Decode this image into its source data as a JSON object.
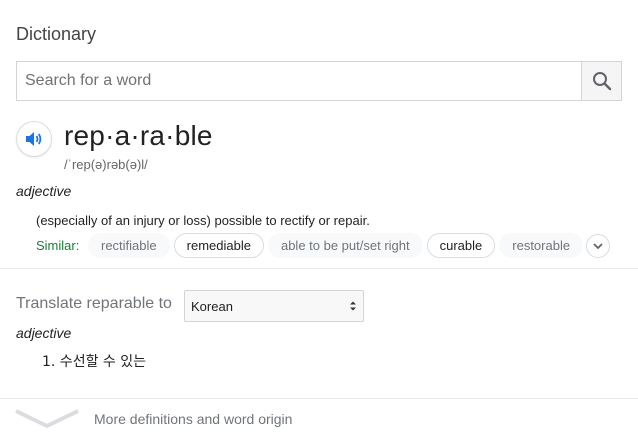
{
  "header": {
    "title": "Dictionary"
  },
  "search": {
    "placeholder": "Search for a word",
    "value": ""
  },
  "entry": {
    "word": "rep·a·ra·ble",
    "phonetic": "/ˈrep(ə)rəb(ə)l/",
    "part_of_speech": "adjective",
    "definition": "(especially of an injury or loss) possible to rectify or repair.",
    "similar_label": "Similar:",
    "similar": [
      {
        "label": "rectifiable",
        "style": "plain"
      },
      {
        "label": "remediable",
        "style": "outlined"
      },
      {
        "label": "able to be put/set right",
        "style": "plain"
      },
      {
        "label": "curable",
        "style": "outlined"
      },
      {
        "label": "restorable",
        "style": "plain"
      }
    ]
  },
  "translate": {
    "label": "Translate reparable to",
    "selected_language": "Korean",
    "part_of_speech": "adjective",
    "items": [
      "1. 수선할 수 있는"
    ]
  },
  "footer": {
    "more_label": "More definitions and word origin"
  },
  "colors": {
    "accent_blue": "#1a73e8",
    "similar_green": "#188038"
  },
  "icons": [
    "search-icon",
    "speaker-icon",
    "chevron-down-icon",
    "select-arrows-icon",
    "wide-chevron-down-icon"
  ]
}
